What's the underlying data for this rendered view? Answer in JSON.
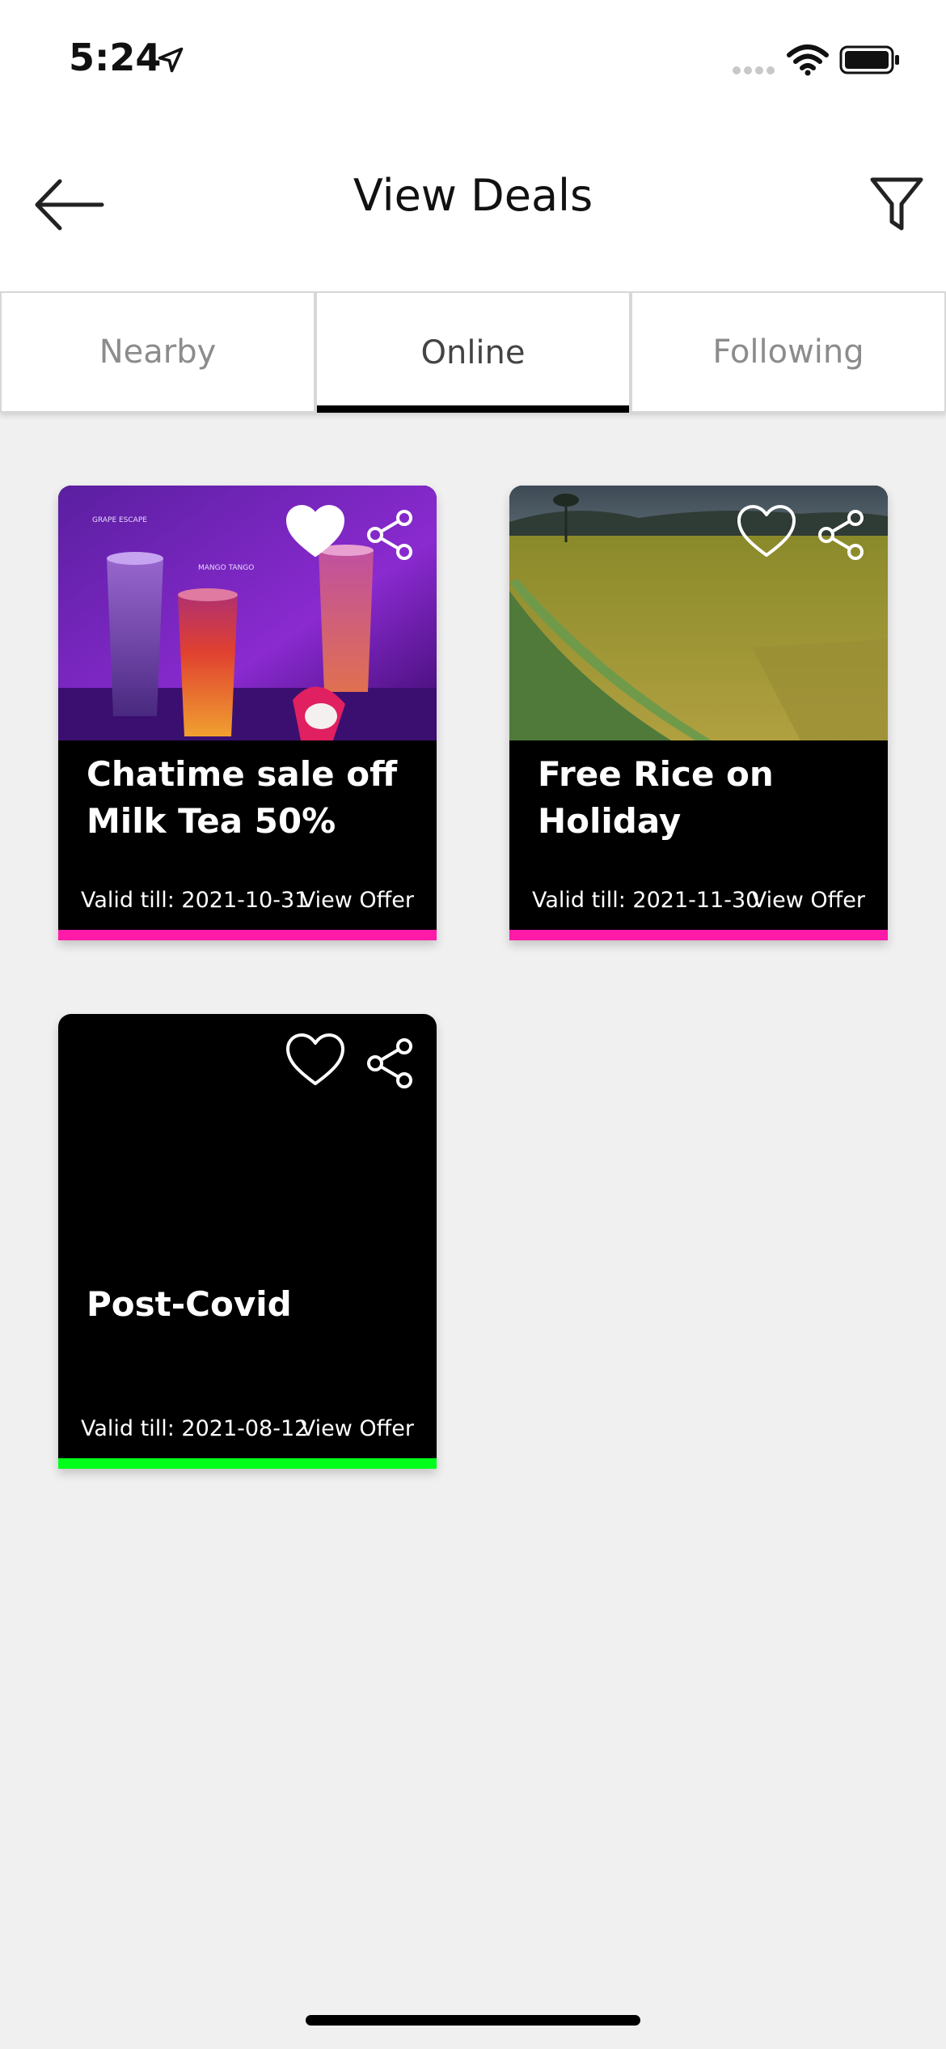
{
  "status_bar": {
    "time": "5:24"
  },
  "header": {
    "title": "View Deals"
  },
  "tabs": [
    {
      "label": "Nearby",
      "active": false
    },
    {
      "label": "Online",
      "active": true
    },
    {
      "label": "Following",
      "active": false
    }
  ],
  "deals": [
    {
      "title": "Chatime sale off Milk Tea 50%",
      "valid": "Valid till: 2021-10-31",
      "view_offer": "View Offer",
      "favorited": true,
      "bar_color": "#ff1aa8",
      "image_labels": [
        "GRAPE ESCAPE",
        "MANGO TANGO"
      ]
    },
    {
      "title": "Free Rice on Holiday",
      "valid": "Valid till: 2021-11-30",
      "view_offer": "View Offer",
      "favorited": false,
      "bar_color": "#ff1aa8"
    },
    {
      "title": "Post-Covid",
      "valid": "Valid till: 2021-08-12",
      "view_offer": "View Offer",
      "favorited": false,
      "bar_color": "#00ff1a"
    }
  ]
}
